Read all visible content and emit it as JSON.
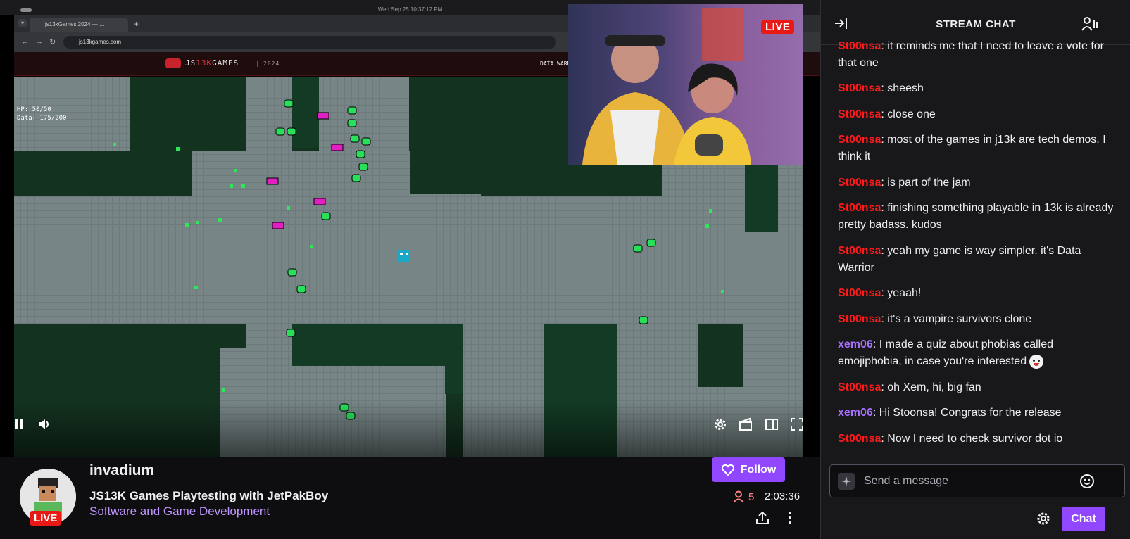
{
  "os": {
    "clock": "Wed Sep 25  10:37:12 PM"
  },
  "browser": {
    "tab_title": "js13kGames 2024 — …",
    "url": "js13kgames.com"
  },
  "game": {
    "logo_prefix": "JS",
    "logo_accent": "13K",
    "logo_suffix": "GAMES",
    "year": "2024",
    "right_title": "DATA WARRIOR",
    "hud": "HP: 50/50\nData: 175/200"
  },
  "video": {
    "pip_live_label": "LIVE",
    "icons": [
      "pause-icon",
      "volume-icon",
      "gear-icon",
      "clip-icon",
      "theatre-mode-icon",
      "fullscreen-icon"
    ]
  },
  "channel": {
    "name": "invadium",
    "live_label": "LIVE",
    "title": "JS13K Games Playtesting with JetPakBoy",
    "category": "Software and Game Development",
    "follow_label": "Follow",
    "viewers": "5",
    "uptime": "2:03:36"
  },
  "chat": {
    "title": "STREAM CHAT",
    "messages": [
      {
        "user": "St00nsa",
        "color": "#ff1a1a",
        "text": "it reminds me that I need to leave a vote for that one"
      },
      {
        "user": "St00nsa",
        "color": "#ff1a1a",
        "text": "sheesh"
      },
      {
        "user": "St00nsa",
        "color": "#ff1a1a",
        "text": "close one"
      },
      {
        "user": "St00nsa",
        "color": "#ff1a1a",
        "text": "most of the games in j13k are tech demos. I think it"
      },
      {
        "user": "St00nsa",
        "color": "#ff1a1a",
        "text": "is part of the jam"
      },
      {
        "user": "St00nsa",
        "color": "#ff1a1a",
        "text": "finishing something playable in 13k is already pretty badass. kudos"
      },
      {
        "user": "St00nsa",
        "color": "#ff1a1a",
        "text": "yeah my game is way simpler. it's Data Warrior"
      },
      {
        "user": "St00nsa",
        "color": "#ff1a1a",
        "text": "yeaah!"
      },
      {
        "user": "St00nsa",
        "color": "#ff1a1a",
        "text": "it's a vampire survivors clone"
      },
      {
        "user": "xem06",
        "color": "#a970ff",
        "text": "I made a quiz about phobias called emojiphobia, in case you're interested",
        "emote": "scared-face-emote"
      },
      {
        "user": "St00nsa",
        "color": "#ff1a1a",
        "text": "oh Xem, hi, big fan"
      },
      {
        "user": "xem06",
        "color": "#a970ff",
        "text": "Hi Stoonsa! Congrats for the release"
      },
      {
        "user": "St00nsa",
        "color": "#ff1a1a",
        "text": "Now I need to check survivor dot io"
      }
    ],
    "input_placeholder": "Send a message",
    "chat_button": "Chat"
  },
  "colors": {
    "accent": "#9147ff",
    "live": "#e91916",
    "category": "#bf94ff",
    "viewers": "#ff8280"
  }
}
